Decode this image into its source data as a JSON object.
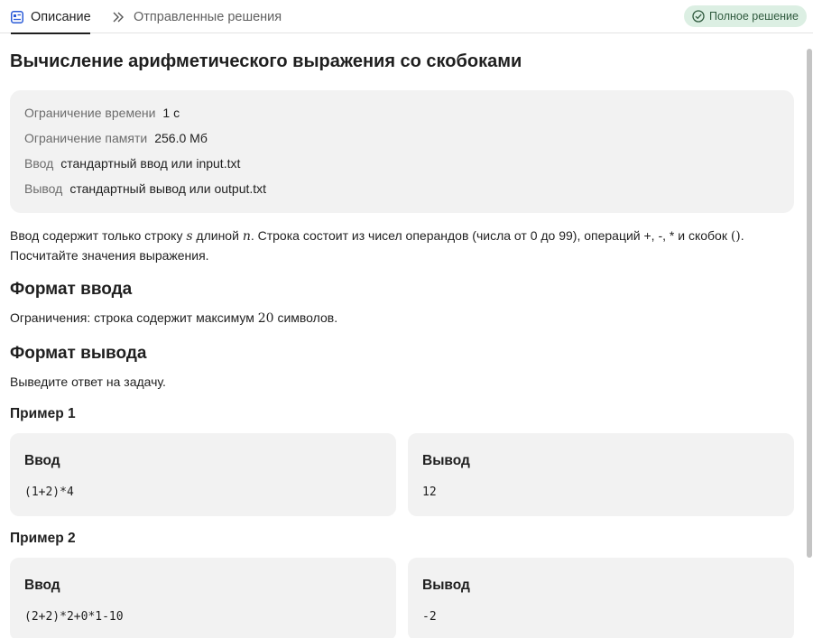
{
  "tabs": {
    "description": "Описание",
    "submissions": "Отправленные решения",
    "status_badge": "Полное решение"
  },
  "problem": {
    "title": "Вычисление арифметического выражения со скобоками",
    "limits": {
      "time_label": "Ограничение времени",
      "time_value": "1 с",
      "memory_label": "Ограничение памяти",
      "memory_value": "256.0 Мб",
      "input_label": "Ввод",
      "input_value": "стандартный ввод или input.txt",
      "output_label": "Вывод",
      "output_value": "стандартный вывод или output.txt"
    },
    "statement": {
      "p1": "Ввод содержит только строку ",
      "var_s": "s",
      "p2": " длиной ",
      "var_n": "n",
      "p3": ". Строка состоит из чисел операндов (числа от 0 до 99), операций +, -, * и скобок ",
      "parens": "()",
      "p4": ".",
      "line2": "Посчитайте значения выражения."
    },
    "input_format": {
      "heading": "Формат ввода",
      "t1": "Ограничения: строка содержит максимум ",
      "num": "20",
      "t2": " символов."
    },
    "output_format": {
      "heading": "Формат вывода",
      "text": "Выведите ответ на задачу."
    },
    "examples": [
      {
        "heading": "Пример 1",
        "input_label": "Ввод",
        "input": "(1+2)*4",
        "output_label": "Вывод",
        "output": "12"
      },
      {
        "heading": "Пример 2",
        "input_label": "Ввод",
        "input": "(2+2)*2+0*1-10",
        "output_label": "Вывод",
        "output": "-2"
      }
    ]
  },
  "colors": {
    "badge_bg": "#dcefe3",
    "badge_text": "#2f5a3e",
    "card_bg": "#f2f2f2",
    "description_icon": "#2a5bd7"
  },
  "icons": {
    "description": "description-card-icon",
    "submissions": "double-chevron-right-icon",
    "status": "check-circle-icon"
  }
}
